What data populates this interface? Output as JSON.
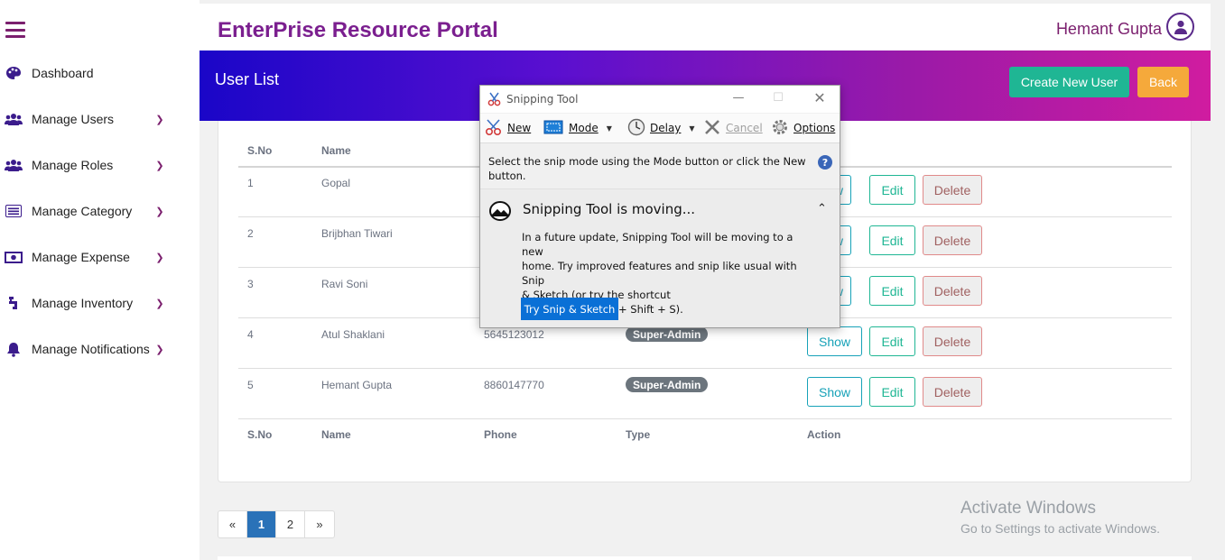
{
  "sidebar": {
    "items": [
      {
        "label": "Dashboard",
        "icon": "palette-icon",
        "has_chevron": false
      },
      {
        "label": "Manage Users",
        "icon": "users-icon",
        "has_chevron": true
      },
      {
        "label": "Manage Roles",
        "icon": "users-icon",
        "has_chevron": true
      },
      {
        "label": "Manage Category",
        "icon": "list-icon",
        "has_chevron": true
      },
      {
        "label": "Manage Expense",
        "icon": "money-icon",
        "has_chevron": true
      },
      {
        "label": "Manage Inventory",
        "icon": "inventory-icon",
        "has_chevron": true
      },
      {
        "label": "Manage Notifications",
        "icon": "bell-icon",
        "has_chevron": true
      }
    ]
  },
  "header": {
    "title": "EnterPrise Resource Portal",
    "username": "Hemant Gupta"
  },
  "banner": {
    "title": "User List",
    "create_label": "Create New User",
    "back_label": "Back"
  },
  "table": {
    "columns": [
      "S.No",
      "Name",
      "Phone",
      "Type",
      "Action"
    ],
    "rows": [
      {
        "sno": "1",
        "name": "Gopal",
        "phone": "",
        "type": ""
      },
      {
        "sno": "2",
        "name": "Brijbhan Tiwari",
        "phone": "",
        "type": ""
      },
      {
        "sno": "3",
        "name": "Ravi Soni",
        "phone": "",
        "type": ""
      },
      {
        "sno": "4",
        "name": "Atul Shaklani",
        "phone": "5645123012",
        "type": "Super-Admin"
      },
      {
        "sno": "5",
        "name": "Hemant Gupta",
        "phone": "8860147770",
        "type": "Super-Admin"
      }
    ],
    "actions": {
      "show": "Show",
      "show_partial": "ow",
      "edit": "Edit",
      "delete": "Delete"
    }
  },
  "pagination": {
    "prev": "«",
    "pages": [
      "1",
      "2"
    ],
    "active": "1",
    "next": "»"
  },
  "watermark": {
    "line1": "Activate Windows",
    "line2": "Go to Settings to activate Windows."
  },
  "snipping_tool": {
    "title": "Snipping Tool",
    "toolbar": {
      "new": "New",
      "mode": "Mode",
      "delay": "Delay",
      "cancel": "Cancel",
      "options": "Options"
    },
    "message": "Select the snip mode using the Mode button or click the New button.",
    "panel_title": "Snipping Tool is moving...",
    "panel_body_lines": [
      "In a future update, Snipping Tool will be moving to a new",
      "home. Try improved features and snip like usual with Snip",
      "& Sketch (or try the shortcut",
      "Windows logo key + Shift + S)."
    ],
    "try_button": "Try Snip & Sketch"
  },
  "colors": {
    "brand_purple": "#7b1f8f",
    "create_button": "#1fb694",
    "back_button": "#f5a93b",
    "pager_active": "#2a72b8",
    "badge": "#6c757d"
  }
}
